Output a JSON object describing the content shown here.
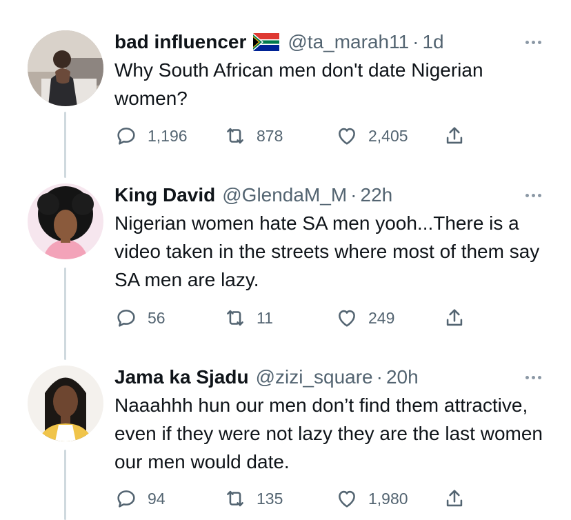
{
  "tweets": [
    {
      "name": "bad influencer",
      "handle": "@ta_marah11",
      "separator": "·",
      "time": "1d",
      "text": "Why South African men don't date Nigerian women?",
      "replies": "1,196",
      "retweets": "878",
      "likes": "2,405"
    },
    {
      "name": "King David",
      "handle": "@GlendaM_M",
      "separator": "·",
      "time": "22h",
      "text": "Nigerian women  hate SA men yooh...There is a video taken in the streets where most of them say SA men are lazy.",
      "replies": "56",
      "retweets": "11",
      "likes": "249"
    },
    {
      "name": "Jama ka Sjadu",
      "handle": "@zizi_square",
      "separator": "·",
      "time": "20h",
      "text": "Naaahhh hun our men don’t find them attractive, even if they were not lazy they are the last women our men would date.",
      "replies": "94",
      "retweets": "135",
      "likes": "1,980"
    }
  ],
  "icons": {
    "reply": "reply-icon",
    "retweet": "retweet-icon",
    "like": "heart-icon",
    "share": "share-icon",
    "more": "more-icon",
    "flag": "south-africa-flag-icon"
  },
  "colors": {
    "text": "#0f1419",
    "secondary": "#536471",
    "thread_line": "#cfd9de"
  }
}
